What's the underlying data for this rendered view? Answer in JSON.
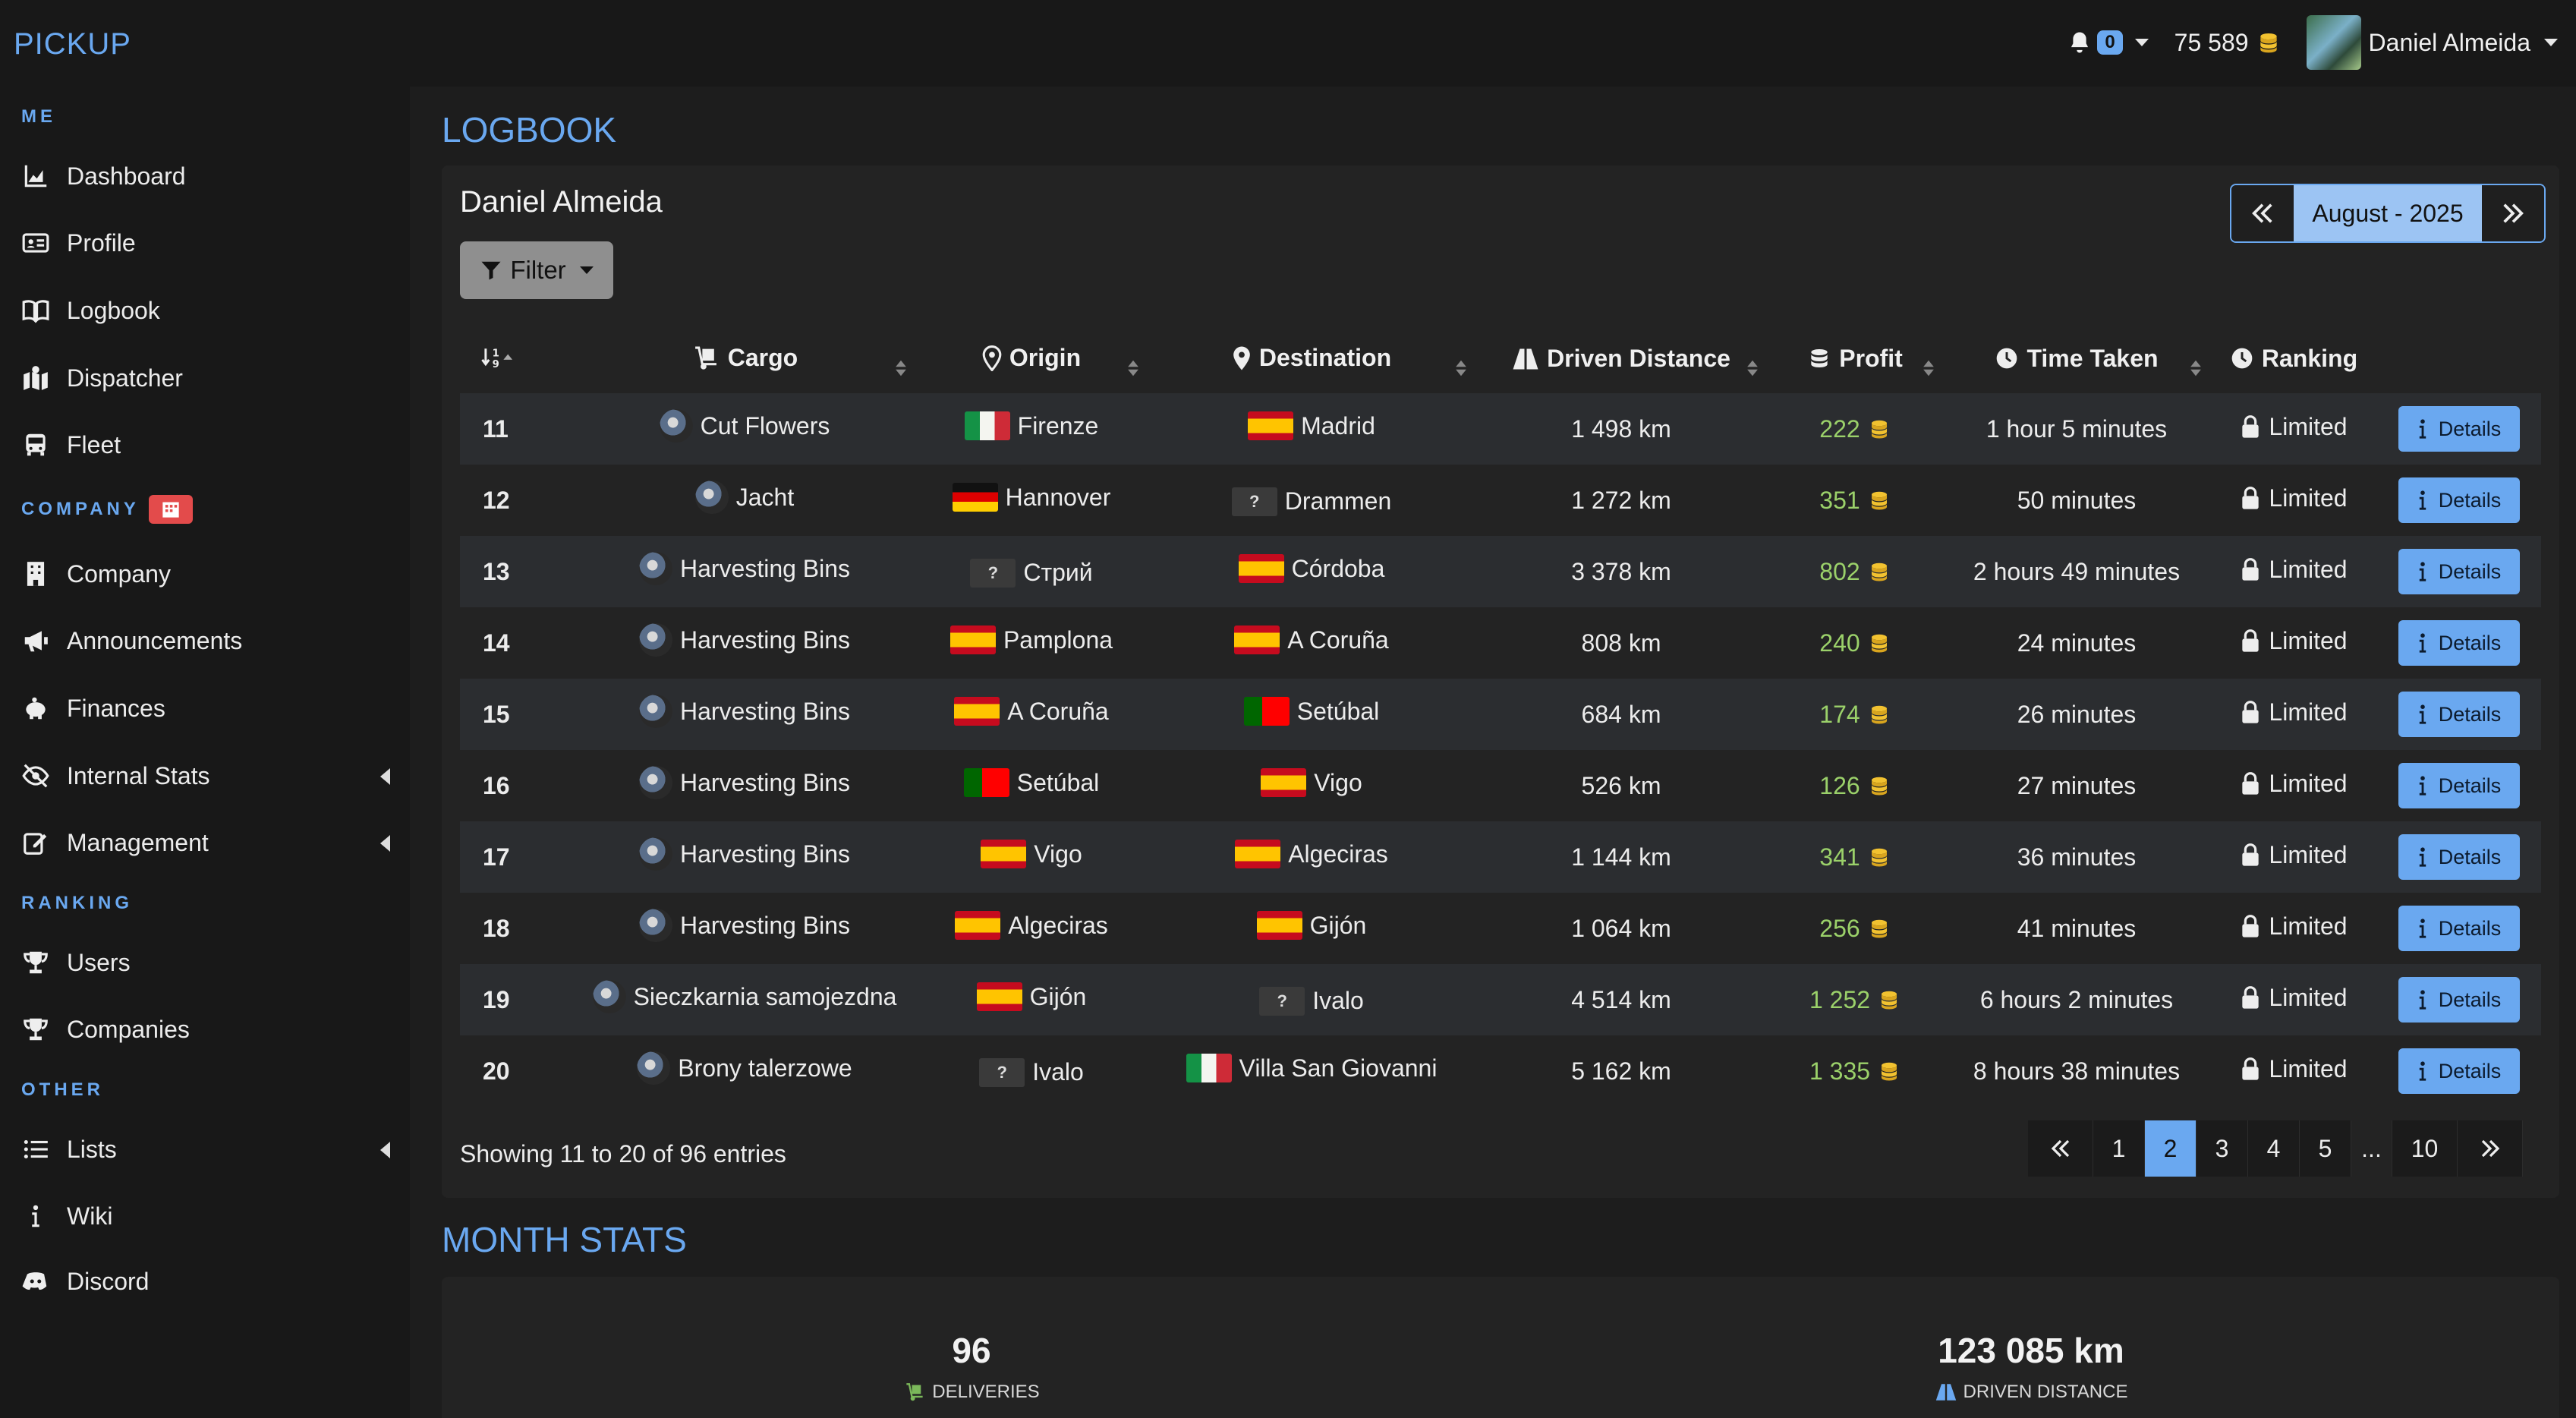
{
  "app": {
    "brand": "PICKUP"
  },
  "topbar": {
    "notifications_count": "0",
    "coins": "75 589",
    "user_name": "Daniel Almeida"
  },
  "sidebar": {
    "sections": {
      "me": "ME",
      "company": "COMPANY",
      "ranking": "RANKING",
      "other": "OTHER"
    },
    "items": {
      "dashboard": "Dashboard",
      "profile": "Profile",
      "logbook": "Logbook",
      "dispatcher": "Dispatcher",
      "fleet": "Fleet",
      "company": "Company",
      "announcements": "Announcements",
      "finances": "Finances",
      "internal_stats": "Internal Stats",
      "management": "Management",
      "users": "Users",
      "companies": "Companies",
      "lists": "Lists",
      "wiki": "Wiki",
      "discord": "Discord"
    }
  },
  "logbook": {
    "title": "LOGBOOK",
    "driver": "Daniel Almeida",
    "filter_label": "Filter",
    "month": "August - 2025",
    "columns": {
      "cargo": "Cargo",
      "origin": "Origin",
      "destination": "Destination",
      "distance": "Driven Distance",
      "profit": "Profit",
      "time": "Time Taken",
      "ranking": "Ranking"
    },
    "details_label": "Details",
    "rows": [
      {
        "id": "11",
        "cargo": "Cut Flowers",
        "origin": "Firenze",
        "origin_flag": "it",
        "dest": "Madrid",
        "dest_flag": "es",
        "distance": "1 498 km",
        "profit": "222",
        "time": "1 hour 5 minutes",
        "ranking": "Limited"
      },
      {
        "id": "12",
        "cargo": "Jacht",
        "origin": "Hannover",
        "origin_flag": "de",
        "dest": "Drammen",
        "dest_flag": "unk",
        "distance": "1 272 km",
        "profit": "351",
        "time": "50 minutes",
        "ranking": "Limited"
      },
      {
        "id": "13",
        "cargo": "Harvesting Bins",
        "origin": "Стрий",
        "origin_flag": "unk",
        "dest": "Córdoba",
        "dest_flag": "es",
        "distance": "3 378 km",
        "profit": "802",
        "time": "2 hours 49 minutes",
        "ranking": "Limited"
      },
      {
        "id": "14",
        "cargo": "Harvesting Bins",
        "origin": "Pamplona",
        "origin_flag": "es",
        "dest": "A Coruña",
        "dest_flag": "es",
        "distance": "808 km",
        "profit": "240",
        "time": "24 minutes",
        "ranking": "Limited"
      },
      {
        "id": "15",
        "cargo": "Harvesting Bins",
        "origin": "A Coruña",
        "origin_flag": "es",
        "dest": "Setúbal",
        "dest_flag": "pt",
        "distance": "684 km",
        "profit": "174",
        "time": "26 minutes",
        "ranking": "Limited"
      },
      {
        "id": "16",
        "cargo": "Harvesting Bins",
        "origin": "Setúbal",
        "origin_flag": "pt",
        "dest": "Vigo",
        "dest_flag": "es",
        "distance": "526 km",
        "profit": "126",
        "time": "27 minutes",
        "ranking": "Limited"
      },
      {
        "id": "17",
        "cargo": "Harvesting Bins",
        "origin": "Vigo",
        "origin_flag": "es",
        "dest": "Algeciras",
        "dest_flag": "es",
        "distance": "1 144 km",
        "profit": "341",
        "time": "36 minutes",
        "ranking": "Limited"
      },
      {
        "id": "18",
        "cargo": "Harvesting Bins",
        "origin": "Algeciras",
        "origin_flag": "es",
        "dest": "Gijón",
        "dest_flag": "es",
        "distance": "1 064 km",
        "profit": "256",
        "time": "41 minutes",
        "ranking": "Limited"
      },
      {
        "id": "19",
        "cargo": "Sieczkarnia samojezdna",
        "origin": "Gijón",
        "origin_flag": "es",
        "dest": "Ivalo",
        "dest_flag": "unk",
        "distance": "4 514 km",
        "profit": "1 252",
        "time": "6 hours 2 minutes",
        "ranking": "Limited"
      },
      {
        "id": "20",
        "cargo": "Brony talerzowe",
        "origin": "Ivalo",
        "origin_flag": "unk",
        "dest": "Villa San Giovanni",
        "dest_flag": "it",
        "distance": "5 162 km",
        "profit": "1 335",
        "time": "8 hours 38 minutes",
        "ranking": "Limited"
      }
    ],
    "showing": "Showing 11 to 20 of 96 entries",
    "pagination": {
      "pages": [
        "1",
        "2",
        "3",
        "4",
        "5"
      ],
      "ellipsis": "...",
      "last": "10",
      "active": "2"
    }
  },
  "month_stats": {
    "title": "MONTH STATS",
    "deliveries_value": "96",
    "deliveries_label": "DELIVERIES",
    "distance_value": "123 085 km",
    "distance_label": "DRIVEN DISTANCE"
  },
  "colors": {
    "accent": "#6aa8f0",
    "profit": "#9bd16a",
    "badge_red": "#e34b4b",
    "background": "#1d1d1d"
  }
}
